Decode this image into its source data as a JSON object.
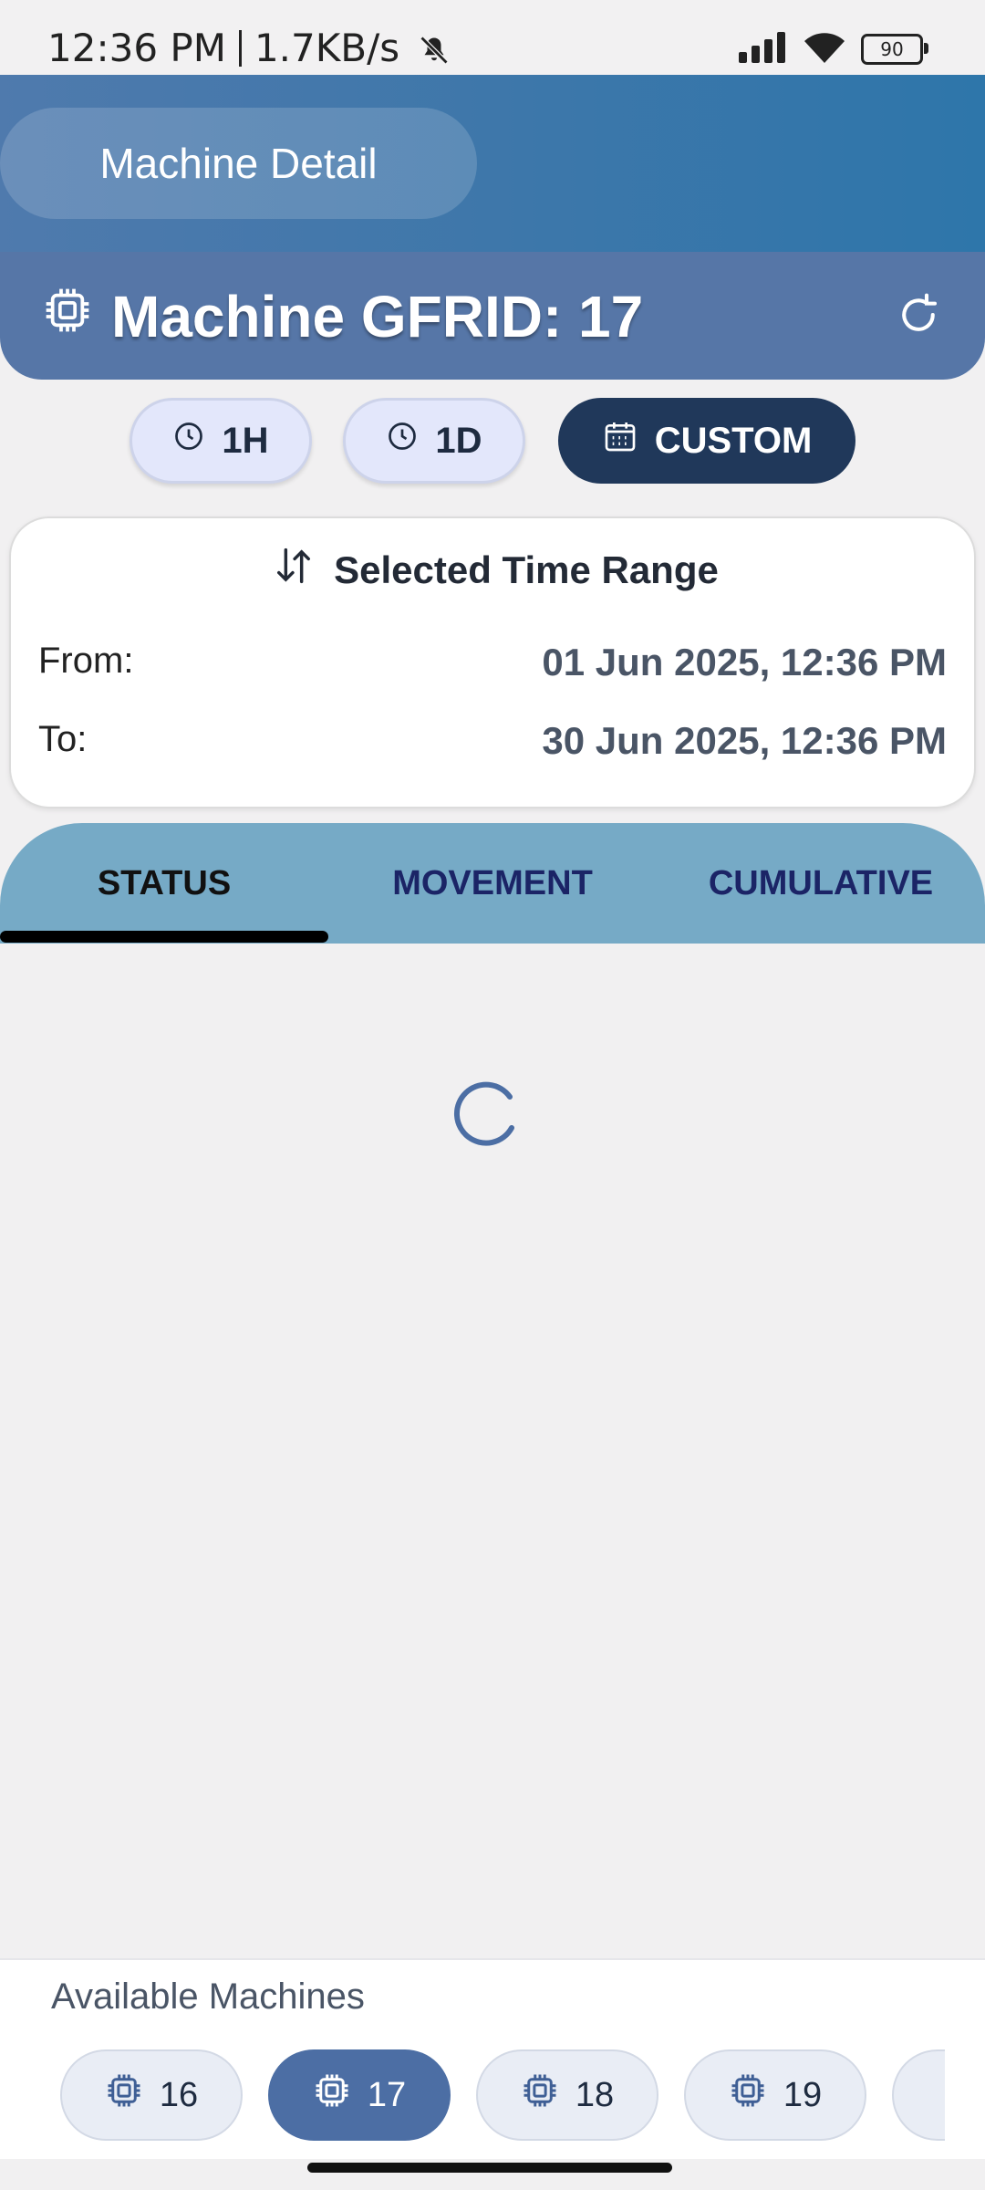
{
  "status_bar": {
    "time": "12:36 PM",
    "network_speed": "1.7KB/s",
    "battery_level": "90",
    "icons": [
      "bell-muted-icon",
      "signal-icon",
      "wifi-icon",
      "battery-icon"
    ]
  },
  "app_bar": {
    "title": "Machine Detail"
  },
  "machine_header": {
    "title": "Machine GFRID: 17",
    "icon": "chip-icon",
    "refresh_icon": "refresh-icon"
  },
  "range_buttons": [
    {
      "label": "1H",
      "icon": "clock-icon",
      "selected": false
    },
    {
      "label": "1D",
      "icon": "clock-icon",
      "selected": false
    },
    {
      "label": "CUSTOM",
      "icon": "calendar-icon",
      "selected": true
    }
  ],
  "time_range": {
    "heading": "Selected Time Range",
    "from_label": "From:",
    "from_value": "01 Jun 2025, 12:36 PM",
    "to_label": "To:",
    "to_value": "30 Jun 2025, 12:36 PM"
  },
  "tabs": [
    {
      "label": "STATUS",
      "active": true
    },
    {
      "label": "MOVEMENT",
      "active": false
    },
    {
      "label": "CUMULATIVE",
      "active": false
    }
  ],
  "content": {
    "state": "loading"
  },
  "available_machines": {
    "label": "Available Machines",
    "machines": [
      {
        "label": "16",
        "active": false
      },
      {
        "label": "17",
        "active": true
      },
      {
        "label": "18",
        "active": false
      },
      {
        "label": "19",
        "active": false
      },
      {
        "label": "",
        "active": false
      }
    ]
  },
  "colors": {
    "header_gradient_start": "#4f7aad",
    "header_gradient_end": "#2e76aa",
    "machine_header": "#5676a7",
    "selected_range": "#20385a",
    "tab_bar": "#76aac6",
    "active_machine": "#4c6ea4"
  }
}
